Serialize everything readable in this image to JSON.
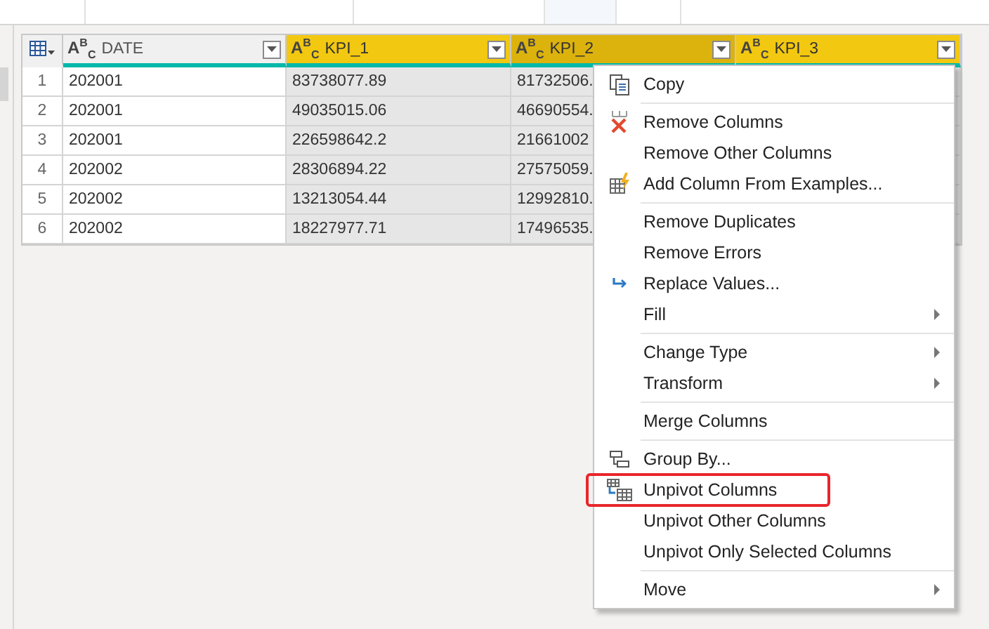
{
  "table": {
    "columns": [
      {
        "name": "DATE",
        "type_glyph": "A$^{B}$$_{C}$",
        "selected": false,
        "hovered": false
      },
      {
        "name": "KPI_1",
        "type_glyph": "A$^{B}$$_{C}$",
        "selected": true,
        "hovered": false
      },
      {
        "name": "KPI_2",
        "type_glyph": "A$^{B}$$_{C}$",
        "selected": true,
        "hovered": true
      },
      {
        "name": "KPI_3",
        "type_glyph": "A$^{B}$$_{C}$",
        "selected": true,
        "hovered": false
      }
    ],
    "rows": [
      {
        "number": "1",
        "cells": [
          "202001",
          "83738077.89",
          "81732506."
        ]
      },
      {
        "number": "2",
        "cells": [
          "202001",
          "49035015.06",
          "46690554."
        ]
      },
      {
        "number": "3",
        "cells": [
          "202001",
          "226598642.2",
          "21661002"
        ]
      },
      {
        "number": "4",
        "cells": [
          "202002",
          "28306894.22",
          "27575059."
        ]
      },
      {
        "number": "5",
        "cells": [
          "202002",
          "13213054.44",
          "12992810."
        ]
      },
      {
        "number": "6",
        "cells": [
          "202002",
          "18227977.71",
          "17496535."
        ]
      }
    ]
  },
  "context_menu": {
    "groups": [
      [
        {
          "label": "Copy",
          "kind": "copy",
          "has_submenu": false,
          "outlined": false
        }
      ],
      [
        {
          "label": "Remove Columns",
          "kind": "remove",
          "has_submenu": false,
          "outlined": false
        },
        {
          "label": "Remove Other Columns",
          "kind": "plain",
          "has_submenu": false,
          "outlined": false
        },
        {
          "label": "Add Column From Examples...",
          "kind": "examples",
          "has_submenu": false,
          "outlined": false
        }
      ],
      [
        {
          "label": "Remove Duplicates",
          "kind": "plain",
          "has_submenu": false,
          "outlined": false
        },
        {
          "label": "Remove Errors",
          "kind": "plain",
          "has_submenu": false,
          "outlined": false
        },
        {
          "label": "Replace Values...",
          "kind": "replace",
          "has_submenu": false,
          "outlined": false
        },
        {
          "label": "Fill",
          "kind": "plain",
          "has_submenu": true,
          "outlined": false
        }
      ],
      [
        {
          "label": "Change Type",
          "kind": "plain",
          "has_submenu": true,
          "outlined": false
        },
        {
          "label": "Transform",
          "kind": "plain",
          "has_submenu": true,
          "outlined": false
        }
      ],
      [
        {
          "label": "Merge Columns",
          "kind": "plain",
          "has_submenu": false,
          "outlined": false
        }
      ],
      [
        {
          "label": "Group By...",
          "kind": "group",
          "has_submenu": false,
          "outlined": false
        },
        {
          "label": "Unpivot Columns",
          "kind": "unpivot",
          "has_submenu": false,
          "outlined": true
        },
        {
          "label": "Unpivot Other Columns",
          "kind": "plain",
          "has_submenu": false,
          "outlined": false
        },
        {
          "label": "Unpivot Only Selected Columns",
          "kind": "plain",
          "has_submenu": false,
          "outlined": false
        }
      ],
      [
        {
          "label": "Move",
          "kind": "plain",
          "has_submenu": true,
          "outlined": false
        }
      ]
    ]
  }
}
